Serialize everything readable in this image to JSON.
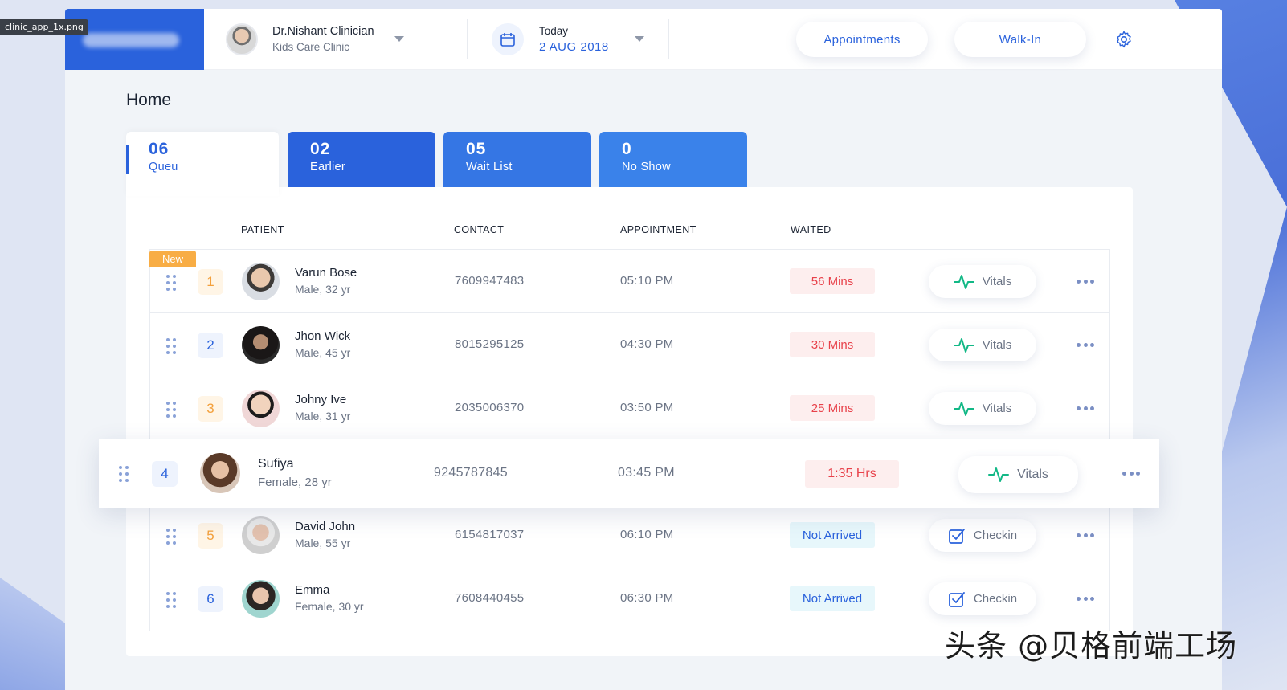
{
  "file_tag": "clinic_app_1x.png",
  "header": {
    "doctor_name": "Dr.Nishant Clinician",
    "clinic_name": "Kids Care Clinic",
    "date_label": "Today",
    "date_value": "2 AUG 2018",
    "appointments_label": "Appointments",
    "walkin_label": "Walk-In"
  },
  "page": {
    "title": "Home"
  },
  "tabs": [
    {
      "count": "06",
      "label": "Queu"
    },
    {
      "count": "02",
      "label": "Earlier"
    },
    {
      "count": "05",
      "label": "Wait List"
    },
    {
      "count": "0",
      "label": "No Show"
    }
  ],
  "table": {
    "headers": {
      "patient": "PATIENT",
      "contact": "CONTACT",
      "appointment": "APPOINTMENT",
      "waited": "WAITED"
    },
    "new_badge": "New",
    "rows": [
      {
        "index": "1",
        "name": "Varun Bose",
        "meta": "Male, 32 yr",
        "contact": "7609947483",
        "time": "05:10 PM",
        "waited": "56 Mins",
        "action": "Vitals"
      },
      {
        "index": "2",
        "name": "Jhon Wick",
        "meta": "Male, 45 yr",
        "contact": "8015295125",
        "time": "04:30 PM",
        "waited": "30 Mins",
        "action": "Vitals"
      },
      {
        "index": "3",
        "name": "Johny Ive",
        "meta": "Male, 31 yr",
        "contact": "2035006370",
        "time": "03:50 PM",
        "waited": "25 Mins",
        "action": "Vitals"
      },
      {
        "index": "4",
        "name": "Sufiya",
        "meta": "Female, 28 yr",
        "contact": "9245787845",
        "time": "03:45 PM",
        "waited": "1:35 Hrs",
        "action": "Vitals"
      },
      {
        "index": "5",
        "name": "David John",
        "meta": "Male, 55 yr",
        "contact": "6154817037",
        "time": "06:10 PM",
        "waited": "Not Arrived",
        "action": "Checkin"
      },
      {
        "index": "6",
        "name": "Emma",
        "meta": "Female, 30 yr",
        "contact": "7608440455",
        "time": "06:30 PM",
        "waited": "Not Arrived",
        "action": "Checkin"
      }
    ]
  },
  "watermark": "头条 @贝格前端工场",
  "colors": {
    "primary": "#2a62dc",
    "orange": "#f3a03c",
    "red": "#e8414a",
    "vitals_green": "#12b886"
  }
}
